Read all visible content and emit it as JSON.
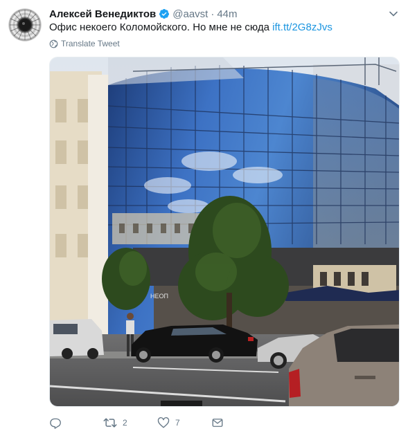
{
  "tweet": {
    "author_name": "Алексей Венедиктов",
    "handle": "@aavst",
    "separator": "·",
    "time": "44m",
    "text_main": "Офис некоего Коломойского. Но мне не сюда ",
    "text_link": "ift.tt/2G8zJvs",
    "translate_label": "Translate Tweet",
    "photo_caption": "Glass office building on a city street",
    "sign_text": "HEOП",
    "actions": {
      "reply_count": "",
      "retweet_count": "2",
      "like_count": "7"
    }
  },
  "colors": {
    "link": "#1b95e0",
    "muted": "#657786",
    "verified": "#1da1f2"
  },
  "icons": [
    "verified-badge-icon",
    "chevron-down-icon",
    "globe-icon",
    "reply-icon",
    "retweet-icon",
    "like-icon",
    "dm-icon"
  ]
}
